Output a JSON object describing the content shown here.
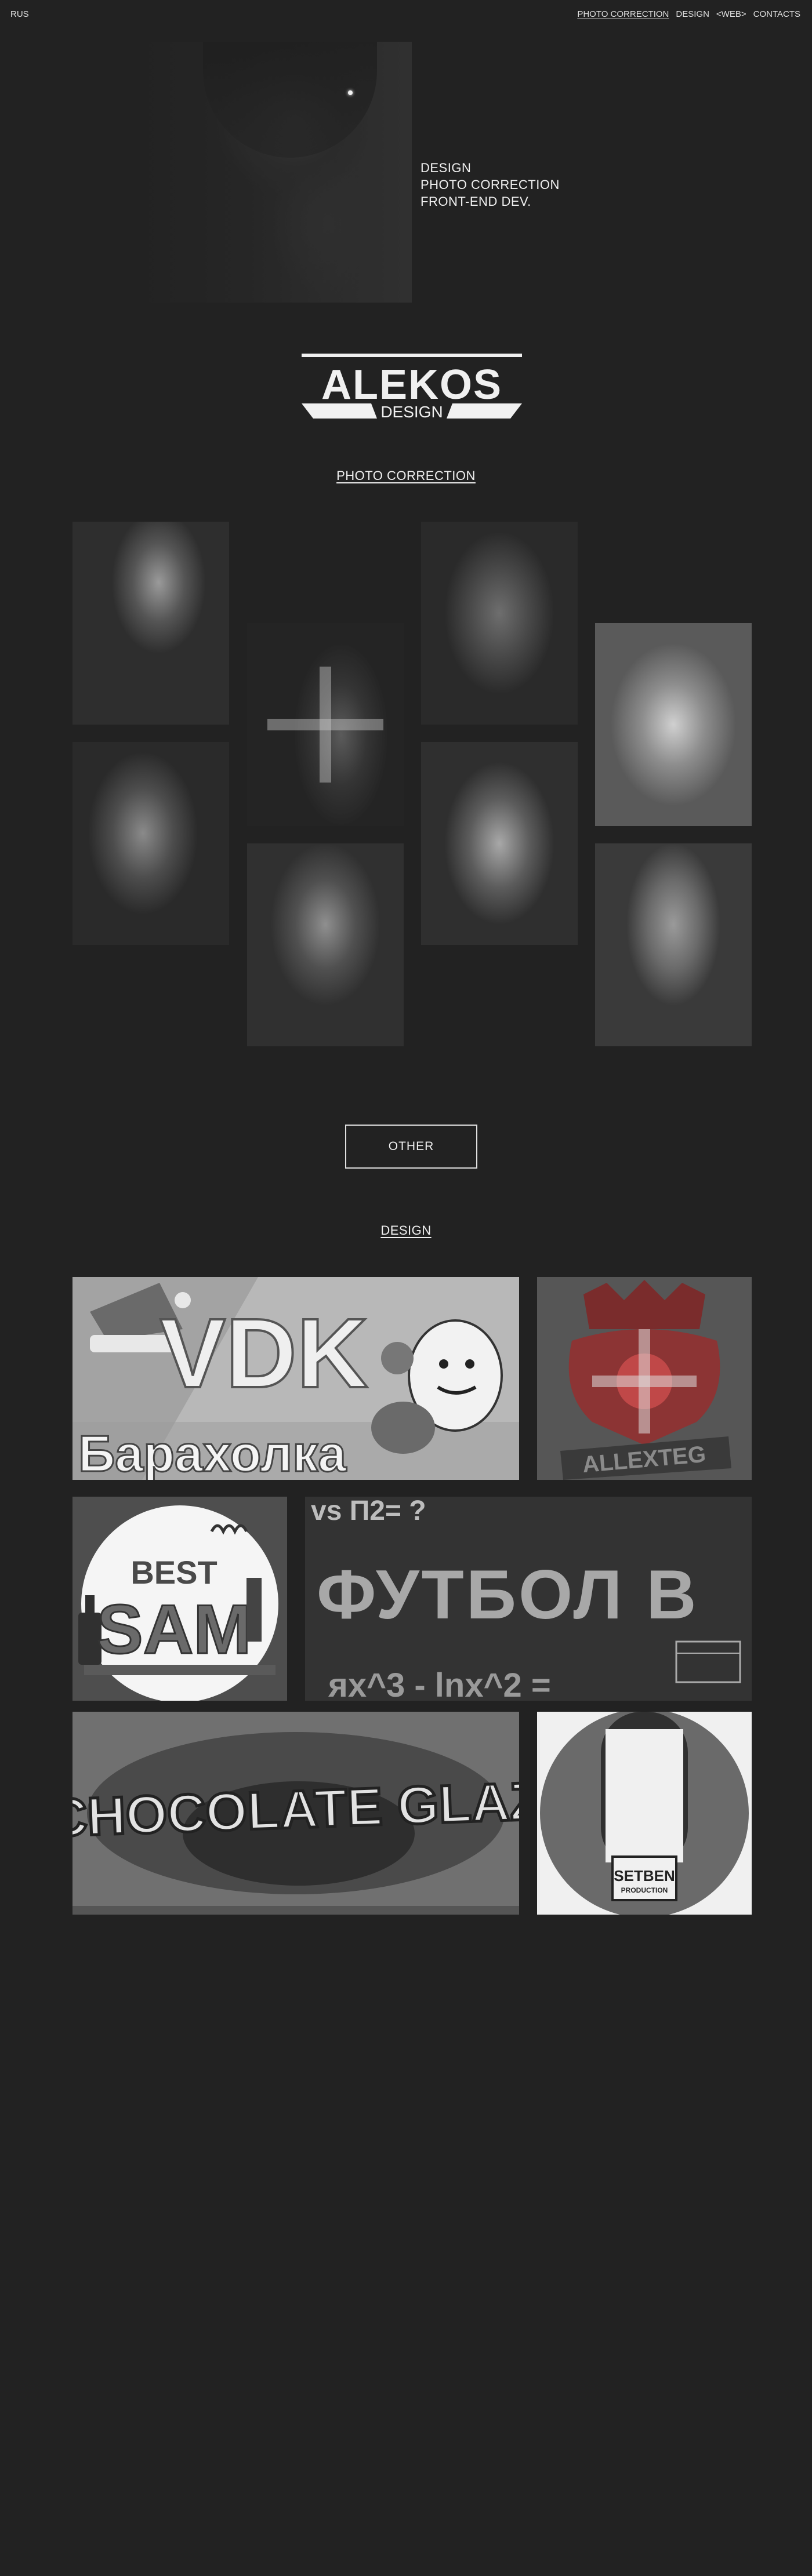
{
  "topbar": {
    "lang": "RUS",
    "nav": [
      "PHOTO CORRECTION",
      "DESIGN",
      "<WEB>",
      "CONTACTS"
    ]
  },
  "hero": {
    "roles": [
      "DESIGN",
      "PHOTO CORRECTION",
      "FRONT-END DEV."
    ]
  },
  "logo": {
    "name": "ALEKOS",
    "sub": "DESIGN"
  },
  "sections": {
    "photo_title": "PHOTO CORRECTION",
    "other_button": "OTHER",
    "design_title": "DESIGN"
  },
  "design_items": {
    "vdk": {
      "title": "VDK",
      "subtitle": "Барахолка"
    },
    "allexteg": {
      "title": "ALLEXTEG"
    },
    "bestsam": {
      "line1": "BEST",
      "line2": "SAM"
    },
    "football": {
      "top": "vs П2= ?",
      "middle": "ФУТБОЛ В",
      "bottom": "яx^3 - lnx^2 ="
    },
    "chocolate": {
      "title": "CHOCOLATE GLAZ"
    },
    "setben": {
      "title": "SETBEN",
      "sub": "PRODUCTION"
    }
  },
  "colors": {
    "background": "#222222",
    "text": "#e8e8e8",
    "allexteg_red": "#8c3434"
  }
}
